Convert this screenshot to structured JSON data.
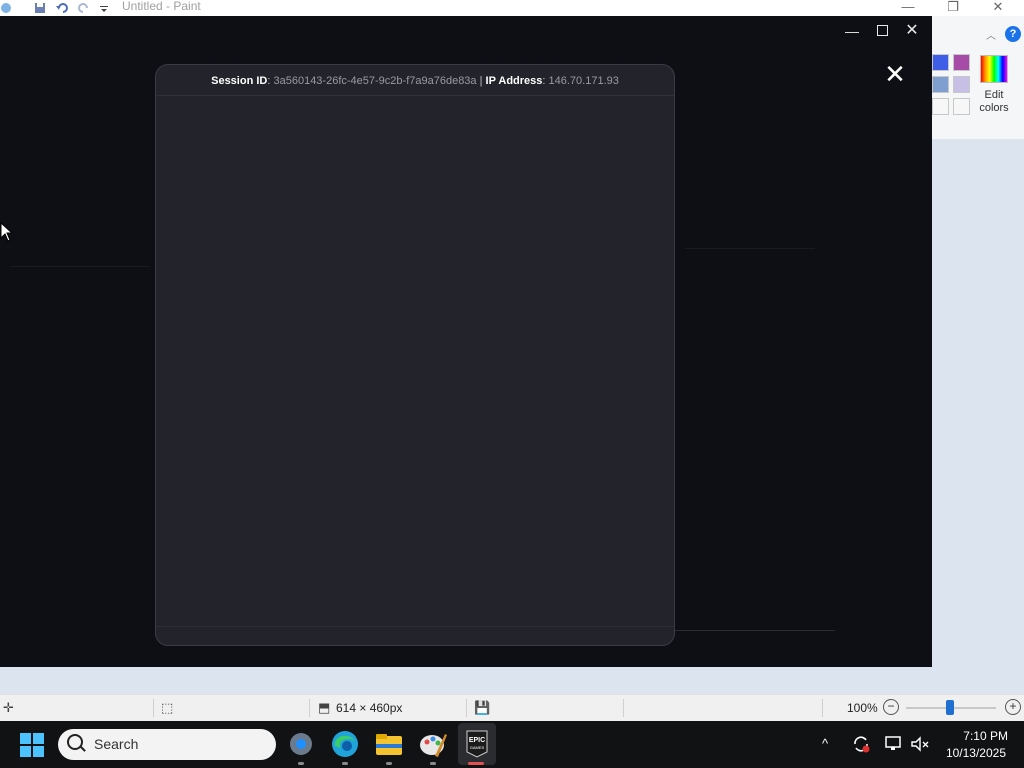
{
  "paint": {
    "title": "Untitled - Paint",
    "edit_colors_label": "Edit colors",
    "help_label": "?",
    "canvas_size": "614 × 460px",
    "zoom": "100%",
    "zoom_minus": "−",
    "zoom_plus": "+",
    "swatch_colors": [
      "#3e5ee8",
      "#a64ca6",
      "#7f9fd1",
      "#c8bfe7",
      "#f7f7f7",
      "#f7f7f7"
    ]
  },
  "overlay": {
    "minimize": "—",
    "close": "✕",
    "modal": {
      "session_label": "Session ID",
      "session_id": "3a560143-26fc-4e57-9c2b-f7a9a76de83a",
      "ip_label": "IP Address",
      "ip_address": "146.70.171.93",
      "close": "✕"
    }
  },
  "taskbar": {
    "search_label": "Search",
    "epic_label": "EPIC GAMES",
    "time": "7:10 PM",
    "date": "10/13/2025",
    "tray": {
      "chevron": "^"
    }
  }
}
